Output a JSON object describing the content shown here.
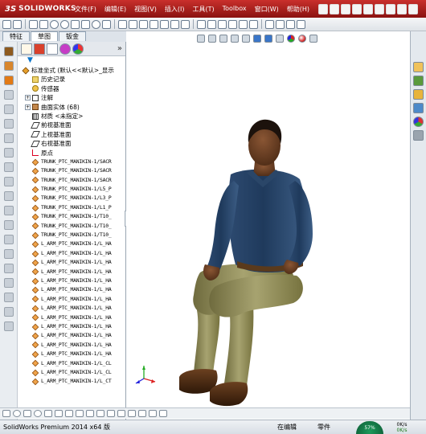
{
  "app": {
    "logo_prefix": "3S",
    "logo_text": "SOLIDWORKS"
  },
  "menubar": [
    {
      "label": "文件(F)"
    },
    {
      "label": "编辑(E)"
    },
    {
      "label": "视图(V)"
    },
    {
      "label": "插入(I)"
    },
    {
      "label": "工具(T)"
    },
    {
      "label": "Toolbox"
    },
    {
      "label": "窗口(W)"
    },
    {
      "label": "帮助(H)"
    }
  ],
  "tabs": [
    {
      "label": "特征"
    },
    {
      "label": "草图"
    },
    {
      "label": "钣金"
    }
  ],
  "tree": {
    "root": "标准坐式 (默认<<默认>_显示",
    "items": [
      {
        "label": "历史记录",
        "icon": "folder-icon"
      },
      {
        "label": "传感器",
        "icon": "sensor-icon"
      },
      {
        "label": "注解",
        "icon": "annotation-icon",
        "expandable": true
      },
      {
        "label": "曲面实体 (68)",
        "icon": "solid-bodies-icon",
        "expandable": true
      },
      {
        "label": "材质 <未指定>",
        "icon": "material-icon"
      },
      {
        "label": "前视基准面",
        "icon": "plane-icon"
      },
      {
        "label": "上视基准面",
        "icon": "plane-icon"
      },
      {
        "label": "右视基准面",
        "icon": "plane-icon"
      },
      {
        "label": "原点",
        "icon": "origin-icon"
      }
    ],
    "features": [
      "TRUNK_PTC_MANIKIN-1/SACR",
      "TRUNK_PTC_MANIKIN-1/SACR",
      "TRUNK_PTC_MANIKIN-1/SACR",
      "TRUNK_PTC_MANIKIN-1/L5_P",
      "TRUNK_PTC_MANIKIN-1/L3_P",
      "TRUNK_PTC_MANIKIN-1/L1_P",
      "TRUNK_PTC_MANIKIN-1/T10_",
      "TRUNK_PTC_MANIKIN-1/T10_",
      "TRUNK_PTC_MANIKIN-1/T10_",
      "L_ARM_PTC_MANIKIN-1/L_HA",
      "L_ARM_PTC_MANIKIN-1/L_HA",
      "L_ARM_PTC_MANIKIN-1/L_HA",
      "L_ARM_PTC_MANIKIN-1/L_HA",
      "L_ARM_PTC_MANIKIN-1/L_HA",
      "L_ARM_PTC_MANIKIN-1/L_HA",
      "L_ARM_PTC_MANIKIN-1/L_HA",
      "L_ARM_PTC_MANIKIN-1/L_HA",
      "L_ARM_PTC_MANIKIN-1/L_HA",
      "L_ARM_PTC_MANIKIN-1/L_HA",
      "L_ARM_PTC_MANIKIN-1/L_HA",
      "L_ARM_PTC_MANIKIN-1/L_HA",
      "L_ARM_PTC_MANIKIN-1/L_HA",
      "L_ARM_PTC_MANIKIN-1/L_CL",
      "L_ARM_PTC_MANIKIN-1/L_CL",
      "L_ARM_PTC_MANIKIN-1/L_CT"
    ]
  },
  "status": {
    "product": "SolidWorks Premium 2014 x64 版",
    "mode": "在编辑",
    "doc_type": "零件",
    "gauge_value": "57%",
    "speed_upload": "0K/s",
    "speed_download": "0K/s"
  },
  "colors": {
    "title_bar": "#b01e1a",
    "shirt": "#1f3a5c",
    "pants": "#8a8654",
    "skin": "#6b3f24",
    "shoes": "#4a2a14"
  }
}
